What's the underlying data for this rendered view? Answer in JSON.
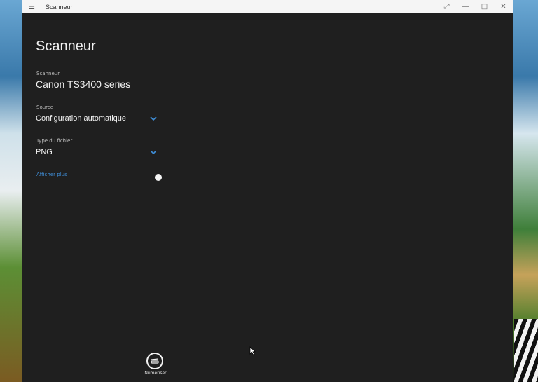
{
  "window": {
    "title": "Scanneur",
    "controls": [
      "expand",
      "minimize",
      "maximize",
      "close"
    ]
  },
  "page": {
    "title": "Scanneur"
  },
  "scanner": {
    "label": "Scanneur",
    "value": "Canon TS3400 series"
  },
  "source": {
    "label": "Source",
    "value": "Configuration automatique"
  },
  "file_type": {
    "label": "Type du fichier",
    "value": "PNG"
  },
  "more_link": "Afficher plus",
  "scan_button": {
    "label": "Numériser"
  },
  "colors": {
    "accent": "#3f8ed8",
    "background": "#1f1f1f",
    "titlebar": "#f5f5f5"
  }
}
